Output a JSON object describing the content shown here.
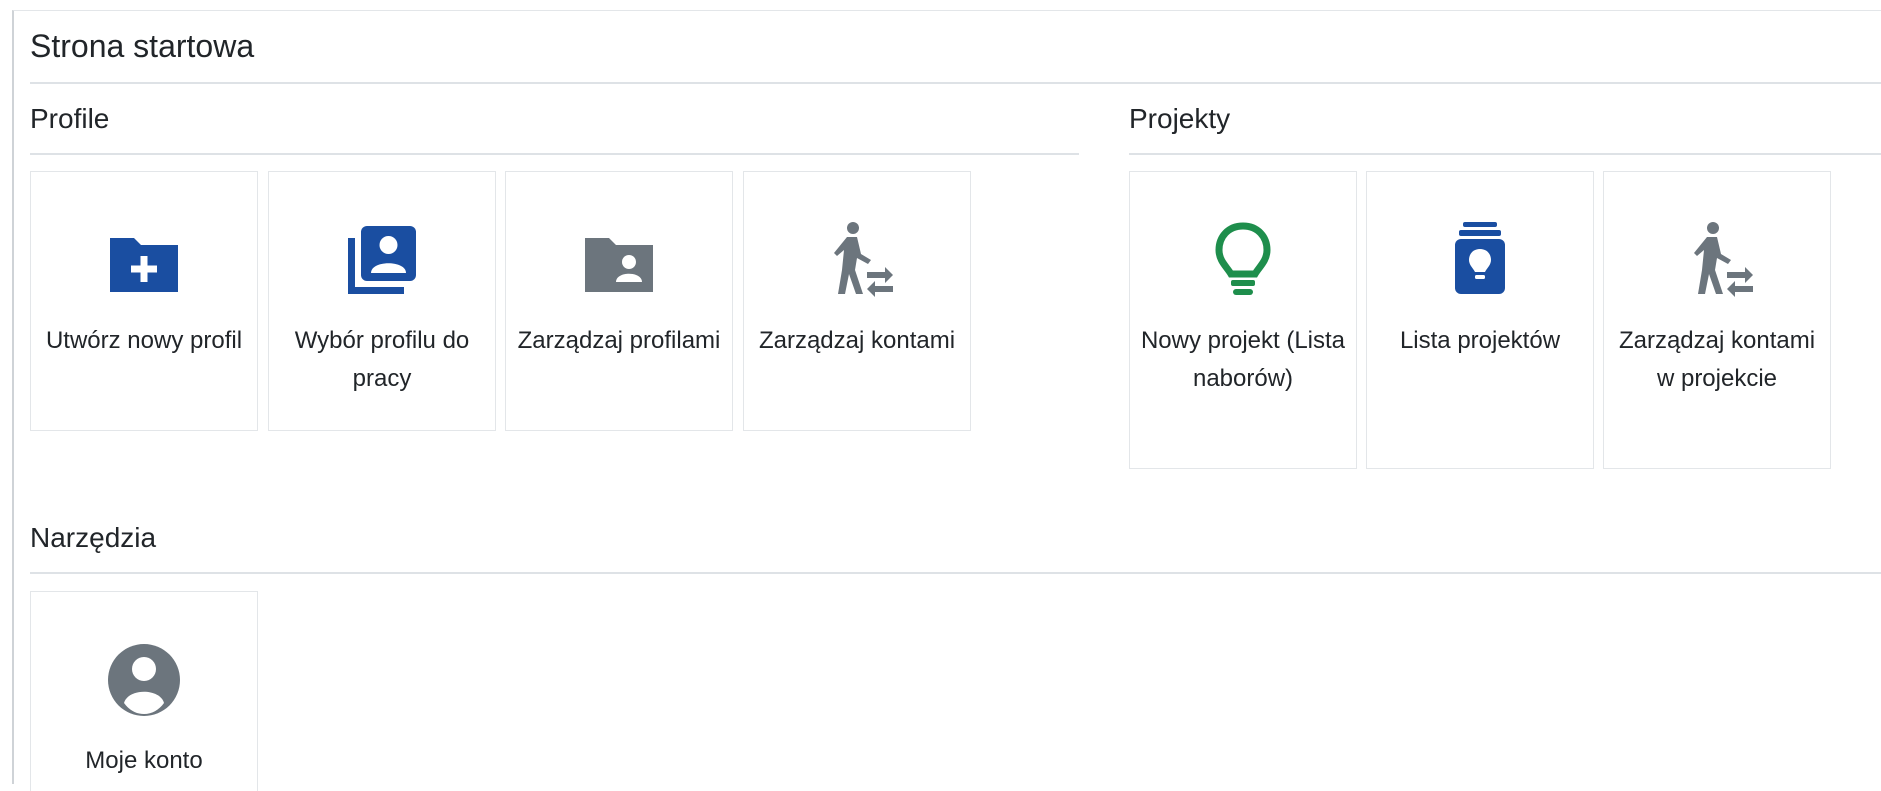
{
  "page": {
    "title": "Strona startowa"
  },
  "sections": {
    "profile": {
      "title": "Profile",
      "tiles": [
        {
          "label": "Utwórz nowy profil",
          "icon": "folder-plus-icon"
        },
        {
          "label": "Wybór profilu do pracy",
          "icon": "profile-stack-icon"
        },
        {
          "label": "Zarządzaj profilami",
          "icon": "folder-user-icon"
        },
        {
          "label": "Zarządzaj kontami",
          "icon": "walking-person-swap-icon"
        }
      ]
    },
    "projekty": {
      "title": "Projekty",
      "tiles": [
        {
          "label": "Nowy projekt (Lista naborów)",
          "icon": "lightbulb-icon"
        },
        {
          "label": "Lista projektów",
          "icon": "lightbulb-stack-icon"
        },
        {
          "label": "Zarządzaj kontami w projekcie",
          "icon": "walking-person-swap-icon"
        }
      ]
    },
    "narzedzia": {
      "title": "Narzędzia",
      "tiles": [
        {
          "label": "Moje konto",
          "icon": "user-circle-icon"
        }
      ]
    }
  },
  "colors": {
    "primary_blue": "#1a4ea1",
    "gray_icon": "#6c757d",
    "green_icon": "#1e8e4c"
  }
}
